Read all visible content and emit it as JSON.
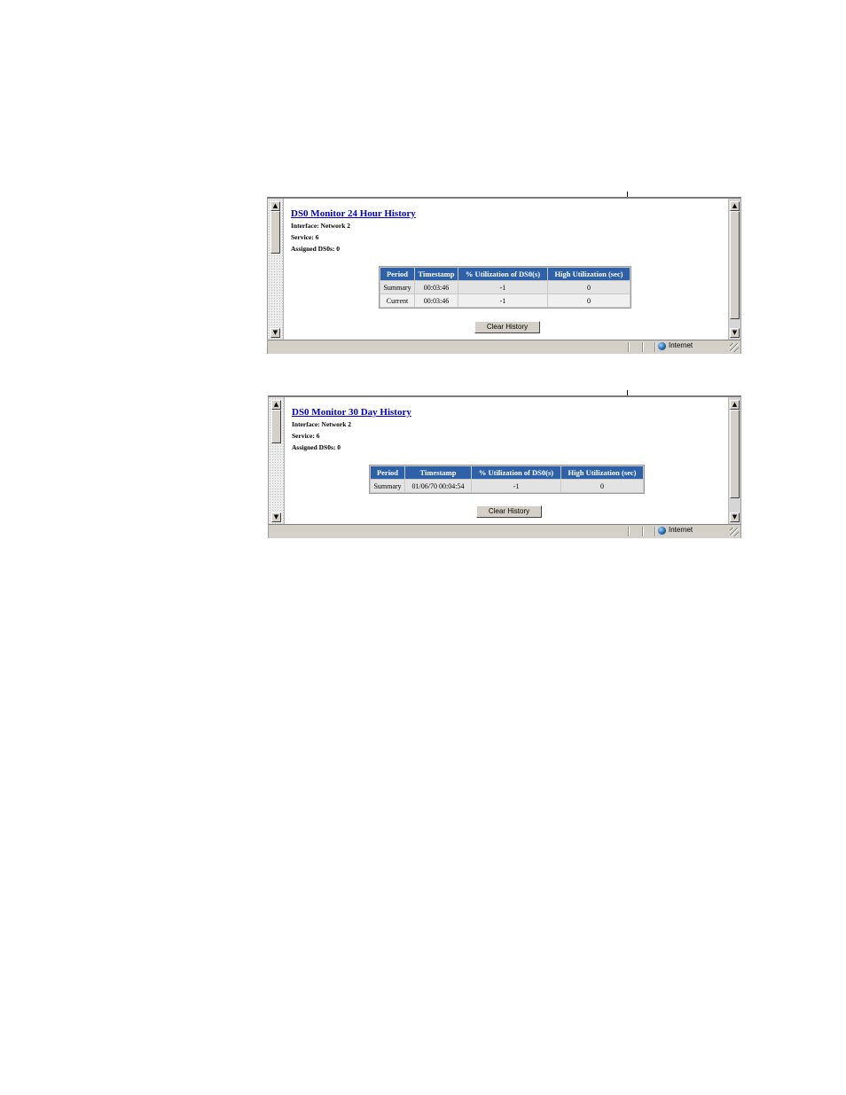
{
  "windows": [
    {
      "title": "DS0 Monitor 24 Hour History",
      "interface": "Interface: Network 2",
      "service": "Service: 6",
      "assigned": "Assigned DS0s: 0",
      "headers": [
        "Period",
        "Timestamp",
        "% Utilization of DS0(s)",
        "High Utilization (sec)"
      ],
      "rows": [
        [
          "Summary",
          "00:03:46",
          "-1",
          "0"
        ],
        [
          "Current",
          "00:03:46",
          "-1",
          "0"
        ]
      ],
      "button": "Clear History",
      "status_zone": "Internet"
    },
    {
      "title": "DS0 Monitor 30 Day History",
      "interface": "Interface: Network 2",
      "service": "Service: 6",
      "assigned": "Assigned DS0s: 0",
      "headers": [
        "Period",
        "Timestamp",
        "% Utilization of DS0(s)",
        "High Utilization (sec)"
      ],
      "rows": [
        [
          "Summary",
          "01/06/70 00:04:54",
          "-1",
          "0"
        ]
      ],
      "button": "Clear History",
      "status_zone": "Internet"
    }
  ],
  "icons": {
    "scroll_up": "▲",
    "scroll_down": "▼",
    "zone": "globe-icon"
  }
}
